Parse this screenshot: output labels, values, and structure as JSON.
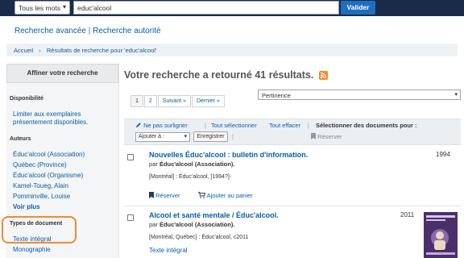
{
  "header": {
    "scope_label": "Tous les mots",
    "search_value": "educ'alcool",
    "search_button": "Valider"
  },
  "links": {
    "advanced": "Recherche avancée",
    "separator": "|",
    "authority": "Recherche autorité"
  },
  "breadcrumb": {
    "home": "Accueil",
    "current": "Résultats de recherche pour 'educ'alcool'"
  },
  "sidebar": {
    "heading": "Affiner votre recherche",
    "availability_title": "Disponibilité",
    "availability_link": "Limiter aux exemplaires présentement disponibles.",
    "authors_title": "Auteurs",
    "authors": [
      "Éduc'alcool (Association)",
      "Québec (Province)",
      "Éduc'alcool (Organisme)",
      "Kamel-Toueg, Alain",
      "Pomminville, Louise"
    ],
    "show_more": "Voir plus",
    "doctype_title": "Types de document",
    "doctypes": [
      "Texte intégral",
      "Monographie"
    ]
  },
  "results": {
    "heading": "Votre recherche a retourné 41 résultats.",
    "pager": [
      "1",
      "2",
      "Suivant  »",
      "Dernier  »"
    ],
    "sort_value": "Pertinence",
    "toolbar": {
      "no_highlight": "Ne pas surligner",
      "select_all": "Tout sélectionner",
      "clear_all": "Tout effacer",
      "select_docs": "Sélectionner des documents pour :",
      "add_to": "Ajouter à :",
      "save": "Enregistrer",
      "reserve": "Réserver"
    },
    "items": [
      {
        "title": "Nouvelles Éduc'alcool : bulletin d'information.",
        "by": "par",
        "author": "Éduc'alcool (Association).",
        "pub": "[Montréal] : Éduc'alcool, [1994?]-",
        "year": "1994",
        "reserve": "Réserver",
        "add_cart": "Ajouter au panier"
      },
      {
        "title": "Alcool et santé mentale / Éduc'alcool.",
        "by": "par",
        "author": "Éduc'alcool (Association).",
        "pub": "[Montréal, Québec] : Éduc'alcool, c2011",
        "year": "2011",
        "fulltext": "Texte intégral"
      }
    ]
  },
  "colors": {
    "topbar": "#1a2b4a",
    "accent": "#1f6fbf",
    "link": "#0b5da6",
    "highlight": "#f28a2d"
  },
  "icons": {
    "rss": "rss-icon",
    "pencil": "pencil-icon",
    "bookmark": "bookmark-icon",
    "cart": "cart-icon"
  }
}
